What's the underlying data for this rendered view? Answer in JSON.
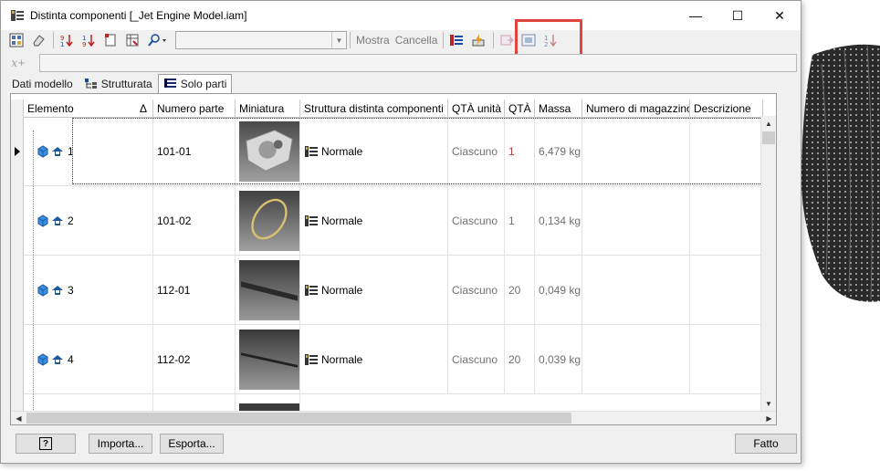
{
  "window": {
    "title": "Distinta componenti [_Jet Engine Model.iam]",
    "minimize": "—",
    "maximize": "☐",
    "close": "✕"
  },
  "toolbar": {
    "show_label": "Mostra",
    "clear_label": "Cancella"
  },
  "tabs": [
    {
      "label": "Dati modello"
    },
    {
      "label": "Strutturata"
    },
    {
      "label": "Solo parti"
    }
  ],
  "grid": {
    "columns": [
      {
        "label": "Elemento"
      },
      {
        "label": "Numero parte"
      },
      {
        "label": "Miniatura"
      },
      {
        "label": "Struttura distinta componenti"
      },
      {
        "label": "QTÀ unità"
      },
      {
        "label": "QTÀ"
      },
      {
        "label": "Massa"
      },
      {
        "label": "Numero di magazzino"
      },
      {
        "label": "Descrizione"
      }
    ],
    "sort_indicator": "Δ",
    "rows": [
      {
        "item": "1",
        "part": "101-01",
        "structure": "Normale",
        "unit_qty": "Ciascuno",
        "qty": "1",
        "mass": "6,479 kg",
        "stock": "",
        "desc": ""
      },
      {
        "item": "2",
        "part": "101-02",
        "structure": "Normale",
        "unit_qty": "Ciascuno",
        "qty": "1",
        "mass": "0,134 kg",
        "stock": "",
        "desc": ""
      },
      {
        "item": "3",
        "part": "112-01",
        "structure": "Normale",
        "unit_qty": "Ciascuno",
        "qty": "20",
        "mass": "0,049 kg",
        "stock": "",
        "desc": ""
      },
      {
        "item": "4",
        "part": "112-02",
        "structure": "Normale",
        "unit_qty": "Ciascuno",
        "qty": "20",
        "mass": "0,039 kg",
        "stock": "",
        "desc": ""
      }
    ]
  },
  "footer": {
    "help_label": "?",
    "import_label": "Importa...",
    "export_label": "Esporta...",
    "done_label": "Fatto"
  },
  "colors": {
    "highlight": "#e0453c",
    "selection_arrow": "#000000",
    "qty_one": "#b04040"
  }
}
